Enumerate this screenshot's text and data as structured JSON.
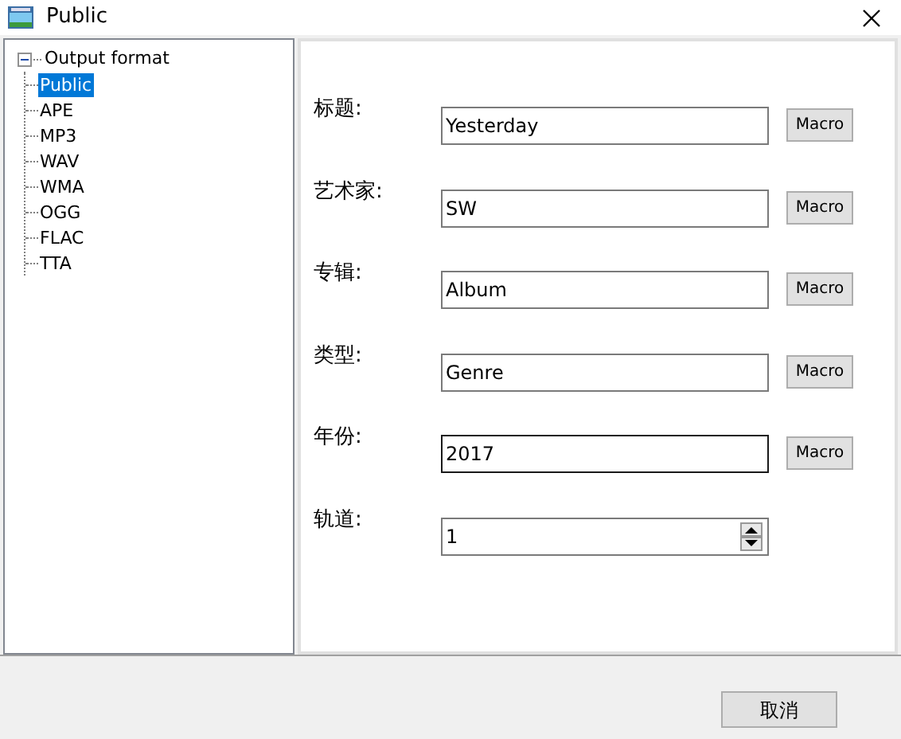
{
  "window": {
    "title": "Public"
  },
  "tree": {
    "label": "Output format",
    "expanded": true,
    "children": [
      {
        "label": "Public",
        "selected": true
      },
      {
        "label": "APE",
        "selected": false
      },
      {
        "label": "MP3",
        "selected": false
      },
      {
        "label": "WAV",
        "selected": false
      },
      {
        "label": "WMA",
        "selected": false
      },
      {
        "label": "OGG",
        "selected": false
      },
      {
        "label": "FLAC",
        "selected": false
      },
      {
        "label": "TTA",
        "selected": false
      }
    ]
  },
  "fields": [
    {
      "kind": "text",
      "label": "标题:",
      "value": "Yesterday",
      "focused": false,
      "button": "Macro"
    },
    {
      "kind": "text",
      "label": "艺术家:",
      "value": "SW",
      "focused": false,
      "button": "Macro"
    },
    {
      "kind": "text",
      "label": "专辑:",
      "value": "Album",
      "focused": false,
      "button": "Macro"
    },
    {
      "kind": "text",
      "label": "类型:",
      "value": "Genre",
      "focused": false,
      "button": "Macro"
    },
    {
      "kind": "text",
      "label": "年份:",
      "value": "2017",
      "focused": true,
      "button": "Macro"
    },
    {
      "kind": "spin",
      "label": "轨道:",
      "value": "1",
      "focused": false
    }
  ],
  "buttons": [
    {
      "label": "取消"
    }
  ]
}
